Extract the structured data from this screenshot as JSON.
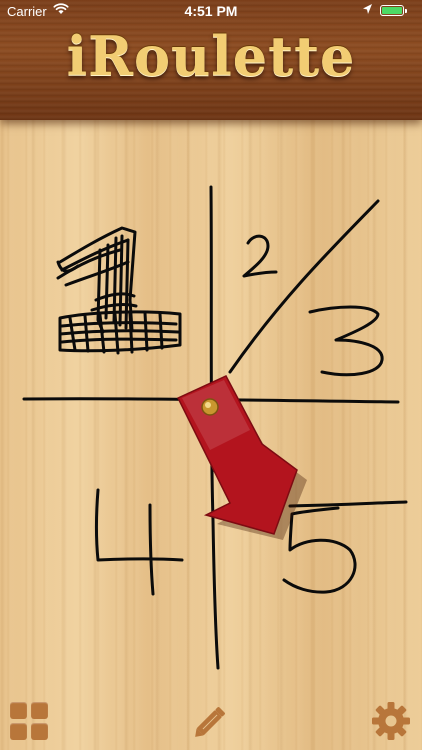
{
  "status_bar": {
    "carrier": "Carrier",
    "time": "4:51 PM",
    "battery_level": 1.0
  },
  "header": {
    "title": "iRoulette"
  },
  "board": {
    "handwritten_numbers": [
      "1",
      "2",
      "3",
      "4",
      "5"
    ],
    "pointer_color": "#b3141e"
  },
  "toolbar": {
    "left_icon": "grid-icon",
    "center_icon": "pencil-icon",
    "right_icon": "gear-icon"
  }
}
